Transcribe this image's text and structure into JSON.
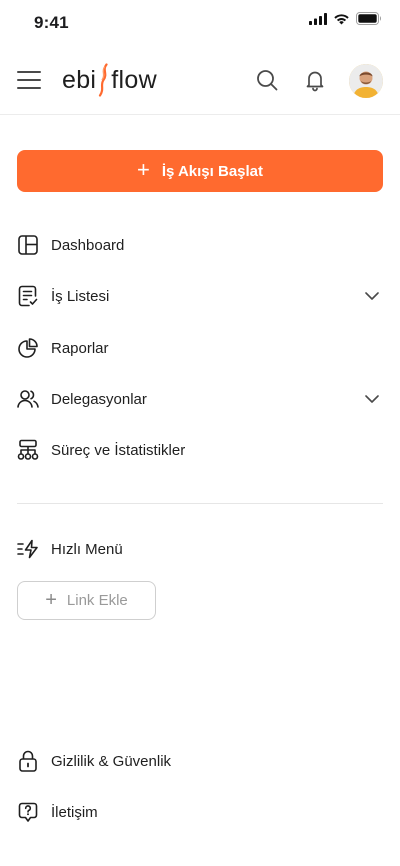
{
  "status_bar": {
    "time": "9:41",
    "signal_icon": "cellular-signal-icon",
    "wifi_icon": "wifi-icon",
    "battery_icon": "battery-icon"
  },
  "header": {
    "menu_icon": "hamburger-menu-icon",
    "logo_text_left": "ebi",
    "logo_text_right": "flow",
    "logo_accent_color": "#ff6a2f",
    "search_icon": "search-icon",
    "notification_icon": "bell-icon",
    "avatar_icon": "user-avatar"
  },
  "cta": {
    "label": "İş Akışı Başlat",
    "icon": "plus-icon",
    "color": "#ff6a2f"
  },
  "nav": {
    "items": [
      {
        "label": "Dashboard",
        "icon": "dashboard-layout-icon",
        "has_chevron": false
      },
      {
        "label": "İş Listesi",
        "icon": "task-list-icon",
        "has_chevron": true
      },
      {
        "label": "Raporlar",
        "icon": "pie-chart-icon",
        "has_chevron": false
      },
      {
        "label": "Delegasyonlar",
        "icon": "users-icon",
        "has_chevron": true
      },
      {
        "label": "Süreç ve İstatistikler",
        "icon": "process-flow-icon",
        "has_chevron": false
      }
    ]
  },
  "quick_menu": {
    "label": "Hızlı Menü",
    "icon": "quick-menu-icon",
    "add_link_label": "Link Ekle",
    "add_link_icon": "plus-icon"
  },
  "footer_nav": {
    "items": [
      {
        "label": "Gizlilik & Güvenlik",
        "icon": "lock-icon"
      },
      {
        "label": "İletişim",
        "icon": "help-chat-icon"
      }
    ]
  }
}
